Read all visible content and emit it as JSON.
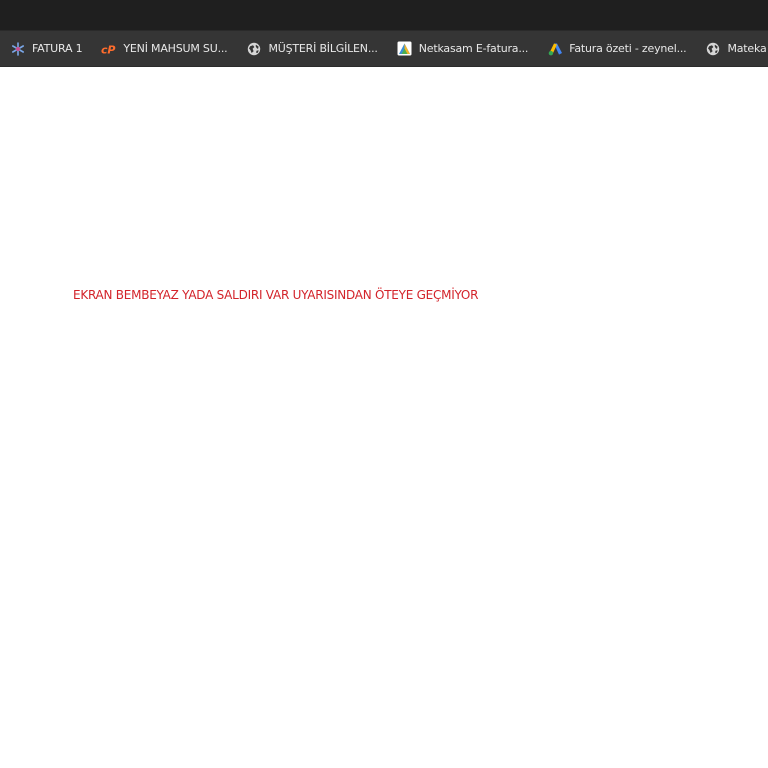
{
  "colors": {
    "top_bar": "#1f1f1f",
    "bookmarks_bar": "#353535",
    "bookmark_text": "#e8e8e8",
    "page_background": "#ffffff",
    "message_text": "#d3232a"
  },
  "bookmarks": [
    {
      "label": "FATURA 1",
      "icon": "snowflake-icon"
    },
    {
      "label": "YENİ MAHSUM SU...",
      "icon": "cpanel-icon"
    },
    {
      "label": "MÜŞTERİ BİLGİLEN...",
      "icon": "globe-icon"
    },
    {
      "label": "Netkasam E-fatura...",
      "icon": "netkasam-icon"
    },
    {
      "label": "Fatura özeti - zeynel...",
      "icon": "google-ads-icon"
    },
    {
      "label": "Mateka Yedek Pa",
      "icon": "globe-icon"
    }
  ],
  "page": {
    "message": "EKRAN BEMBEYAZ YADA SALDIRI VAR UYARISINDAN ÖTEYE GEÇMİYOR"
  }
}
